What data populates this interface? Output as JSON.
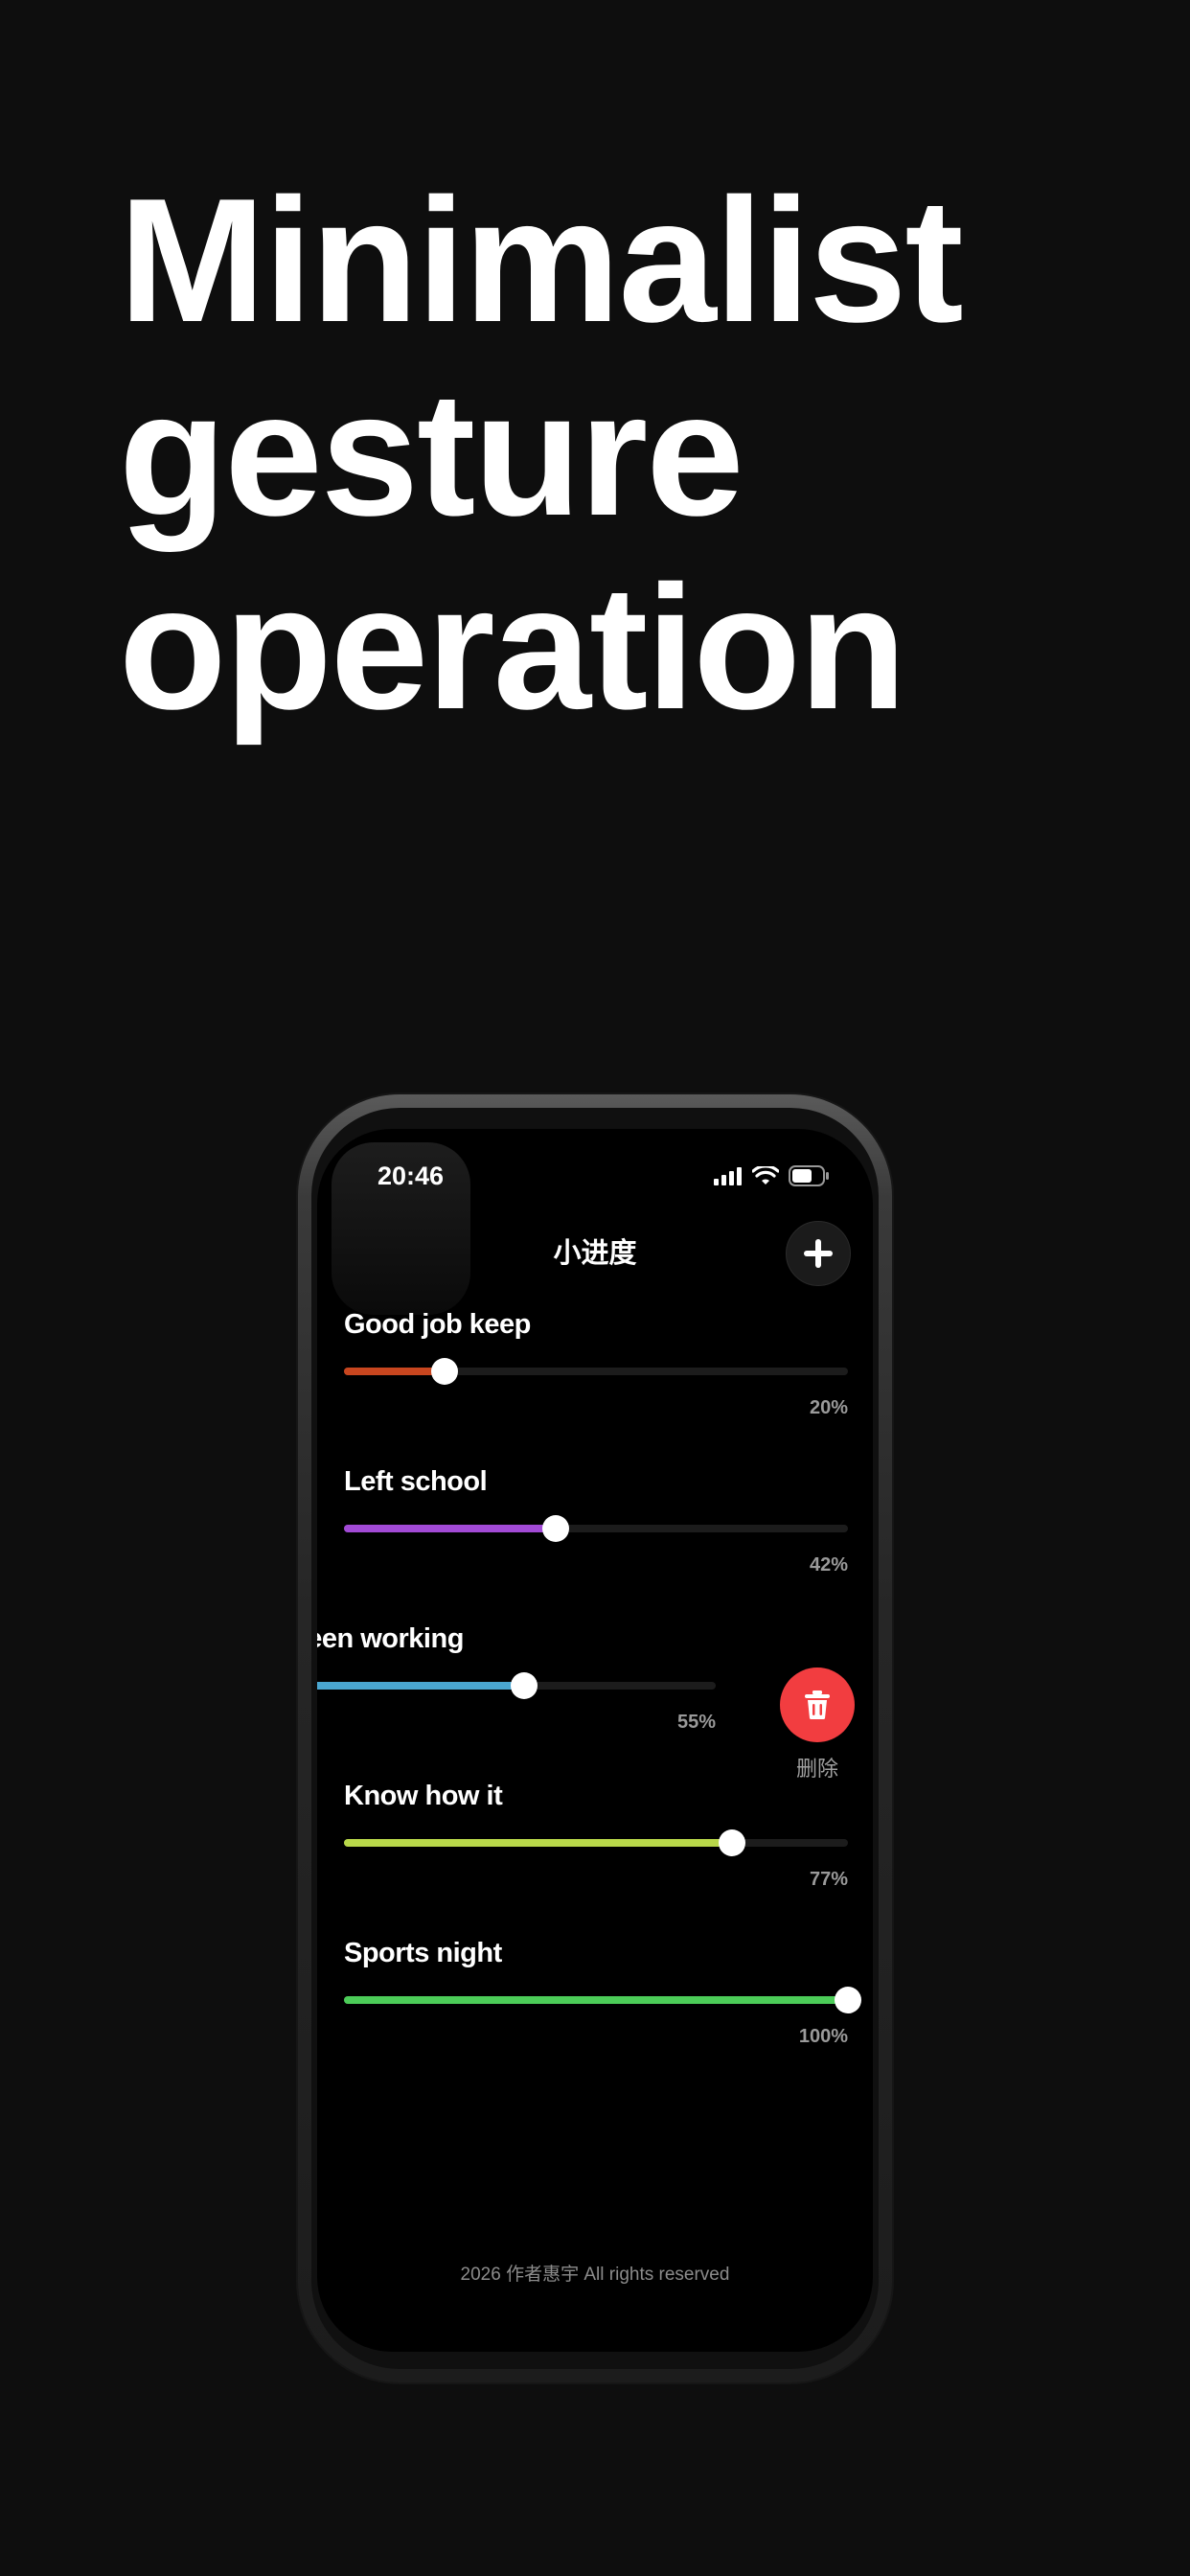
{
  "headline": [
    "Minimalist",
    "gesture",
    "operation"
  ],
  "status_bar": {
    "time": "20:46"
  },
  "nav": {
    "title": "小进度",
    "add_icon": "plus-icon"
  },
  "tasks": [
    {
      "title": "Good job keep",
      "progress": 0.2,
      "percent_label": "20%",
      "color": "#c8461f"
    },
    {
      "title": "Left school",
      "progress": 0.42,
      "percent_label": "42%",
      "color": "#a24ad6"
    },
    {
      "title": "been working",
      "progress": 0.55,
      "percent_label": "55%",
      "color": "#4aa6d0",
      "swiped": true
    },
    {
      "title": "Know how it",
      "progress": 0.77,
      "percent_label": "77%",
      "color": "#b9d84a"
    },
    {
      "title": "Sports night",
      "progress": 1.0,
      "percent_label": "100%",
      "color": "#4ccc58"
    }
  ],
  "delete_action": {
    "label": "删除",
    "icon": "trash-icon",
    "color": "#f23d40"
  },
  "footer": {
    "text": "2026 作者惠宇 All rights reserved"
  }
}
